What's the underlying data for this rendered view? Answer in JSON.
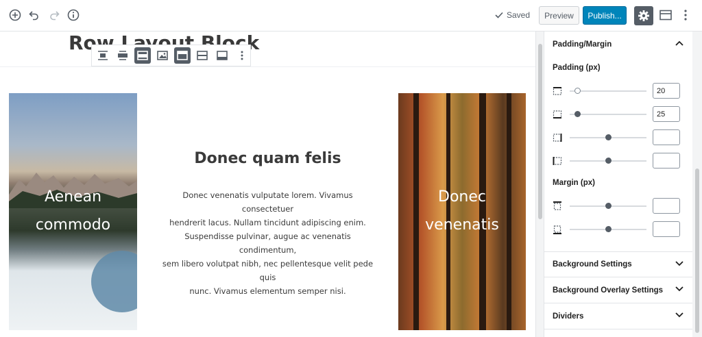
{
  "topbar": {
    "add_icon": "plus-circle-icon",
    "undo_icon": "undo-icon",
    "redo_icon": "redo-icon",
    "info_icon": "info-icon",
    "saved_label": "Saved",
    "preview_label": "Preview",
    "publish_label": "Publish...",
    "settings_icon": "gear-icon",
    "layout_icon": "layout-icon",
    "more_icon": "more-vertical-icon"
  },
  "editor": {
    "block_title": "Row Layout Block",
    "toolbar_buttons": [
      "align-center-icon",
      "align-wide-icon",
      "align-full-icon",
      "image-icon",
      "layout-top-icon",
      "layout-middle-icon",
      "layout-bottom-icon",
      "more-vertical-icon"
    ],
    "left_column": {
      "line1": "Aenean",
      "line2": "commodo"
    },
    "middle_column": {
      "heading": "Donec quam felis",
      "body_lines": [
        "Donec venenatis vulputate lorem. Vivamus consectetuer",
        "hendrerit lacus. Nullam tincidunt adipiscing enim.",
        "Suspendisse pulvinar, augue ac venenatis condimentum,",
        "sem libero volutpat nibh, nec pellentesque velit pede quis",
        "nunc. Vivamus elementum semper nisi."
      ]
    },
    "right_column": {
      "line1": "Donec",
      "line2": "venenatis"
    }
  },
  "sidebar": {
    "padding_margin_title": "Padding/Margin",
    "padding_label": "Padding (px)",
    "padding": [
      {
        "icon": "padding-top-icon",
        "value": "20",
        "level": 0.1
      },
      {
        "icon": "padding-right-icon",
        "value": "25",
        "level": 0.1
      },
      {
        "icon": "padding-bottom-icon",
        "value": "",
        "level": 0.5
      },
      {
        "icon": "padding-left-icon",
        "value": "",
        "level": 0.5
      }
    ],
    "margin_label": "Margin (px)",
    "margin": [
      {
        "icon": "margin-top-icon",
        "value": "",
        "level": 0.5
      },
      {
        "icon": "margin-bottom-icon",
        "value": "",
        "level": 0.5
      }
    ],
    "panels": [
      "Background Settings",
      "Background Overlay Settings",
      "Dividers"
    ]
  },
  "colors": {
    "publish": "#0085ba",
    "settings_active": "#555d66",
    "text_dark": "#3a3a3a"
  }
}
